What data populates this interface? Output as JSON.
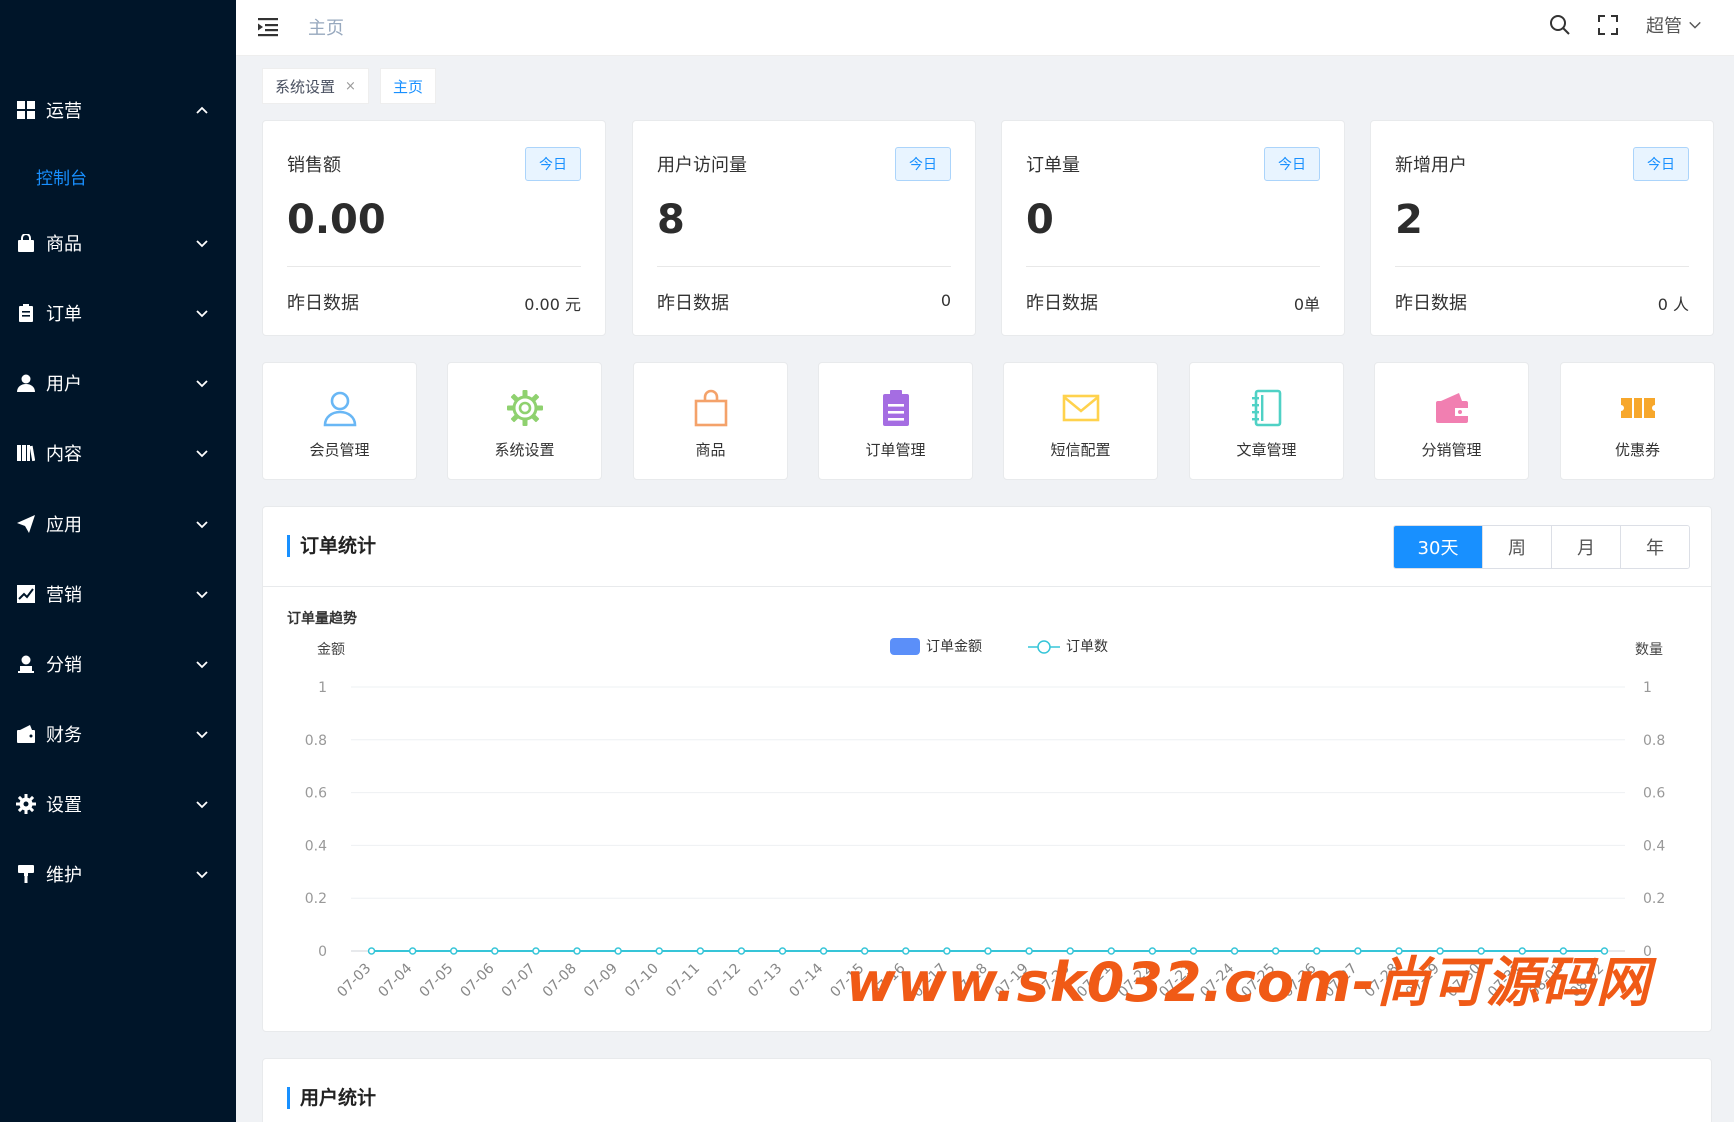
{
  "sidebar": {
    "items": [
      {
        "label": "运营",
        "icon": "dashboard-icon",
        "expanded": true
      },
      {
        "label": "商品",
        "icon": "shopping-bag-icon"
      },
      {
        "label": "订单",
        "icon": "clipboard-icon"
      },
      {
        "label": "用户",
        "icon": "user-icon"
      },
      {
        "label": "内容",
        "icon": "book-icon"
      },
      {
        "label": "应用",
        "icon": "send-icon"
      },
      {
        "label": "营销",
        "icon": "chart-icon"
      },
      {
        "label": "分销",
        "icon": "person-stamp-icon"
      },
      {
        "label": "财务",
        "icon": "wallet-icon"
      },
      {
        "label": "设置",
        "icon": "gear-icon"
      },
      {
        "label": "维护",
        "icon": "paint-roller-icon"
      }
    ],
    "submenu": {
      "label": "控制台"
    }
  },
  "header": {
    "breadcrumb": "主页",
    "user": "超管"
  },
  "tags": [
    {
      "label": "系统设置",
      "closable": true
    },
    {
      "label": "主页",
      "active": true
    }
  ],
  "stats": [
    {
      "title": "销售额",
      "badge": "今日",
      "value": "0.00",
      "y_label": "昨日数据",
      "y_value": "0.00 元"
    },
    {
      "title": "用户访问量",
      "badge": "今日",
      "value": "8",
      "y_label": "昨日数据",
      "y_value": "0"
    },
    {
      "title": "订单量",
      "badge": "今日",
      "value": "0",
      "y_label": "昨日数据",
      "y_value": "0单"
    },
    {
      "title": "新增用户",
      "badge": "今日",
      "value": "2",
      "y_label": "昨日数据",
      "y_value": "0 人"
    }
  ],
  "quick_links": [
    {
      "label": "会员管理",
      "icon": "member-icon",
      "color": "#69b7f5"
    },
    {
      "label": "系统设置",
      "icon": "gear-icon",
      "color": "#8fd16f"
    },
    {
      "label": "商品",
      "icon": "shopping-bag-icon",
      "color": "#f4a26a"
    },
    {
      "label": "订单管理",
      "icon": "clipboard-icon",
      "color": "#a56de2"
    },
    {
      "label": "短信配置",
      "icon": "mail-icon",
      "color": "#ffd24d"
    },
    {
      "label": "文章管理",
      "icon": "notebook-icon",
      "color": "#4fd1c5"
    },
    {
      "label": "分销管理",
      "icon": "wallet-icon",
      "color": "#f17fb1"
    },
    {
      "label": "优惠券",
      "icon": "ticket-icon",
      "color": "#f7a72b"
    }
  ],
  "order_panel": {
    "title": "订单统计",
    "ranges": [
      "30天",
      "周",
      "月",
      "年"
    ],
    "active_range": "30天"
  },
  "user_panel": {
    "title": "用户统计"
  },
  "chart_data": {
    "type": "line",
    "title": "订单量趋势",
    "ylabel_left": "金额",
    "ylabel_right": "数量",
    "ylim": [
      0,
      1
    ],
    "yticks": [
      "0",
      "0.2",
      "0.4",
      "0.6",
      "0.8",
      "1"
    ],
    "legend_position": "top-center",
    "categories": [
      "07-03",
      "07-04",
      "07-05",
      "07-06",
      "07-07",
      "07-08",
      "07-09",
      "07-10",
      "07-11",
      "07-12",
      "07-13",
      "07-14",
      "07-15",
      "07-16",
      "07-17",
      "07-18",
      "07-19",
      "07-20",
      "07-21",
      "07-22",
      "07-23",
      "07-24",
      "07-25",
      "07-26",
      "07-27",
      "07-28",
      "07-29",
      "07-30",
      "07-31",
      "08-01",
      "08-02"
    ],
    "series": [
      {
        "name": "订单金额",
        "kind": "bar",
        "color": "#5b8ff9",
        "values": [
          0,
          0,
          0,
          0,
          0,
          0,
          0,
          0,
          0,
          0,
          0,
          0,
          0,
          0,
          0,
          0,
          0,
          0,
          0,
          0,
          0,
          0,
          0,
          0,
          0,
          0,
          0,
          0,
          0,
          0,
          0
        ]
      },
      {
        "name": "订单数",
        "kind": "line",
        "color": "#36c5d8",
        "values": [
          0,
          0,
          0,
          0,
          0,
          0,
          0,
          0,
          0,
          0,
          0,
          0,
          0,
          0,
          0,
          0,
          0,
          0,
          0,
          0,
          0,
          0,
          0,
          0,
          0,
          0,
          0,
          0,
          0,
          0,
          0
        ]
      }
    ]
  },
  "watermark": "www.sk032.com-尚可源码网"
}
